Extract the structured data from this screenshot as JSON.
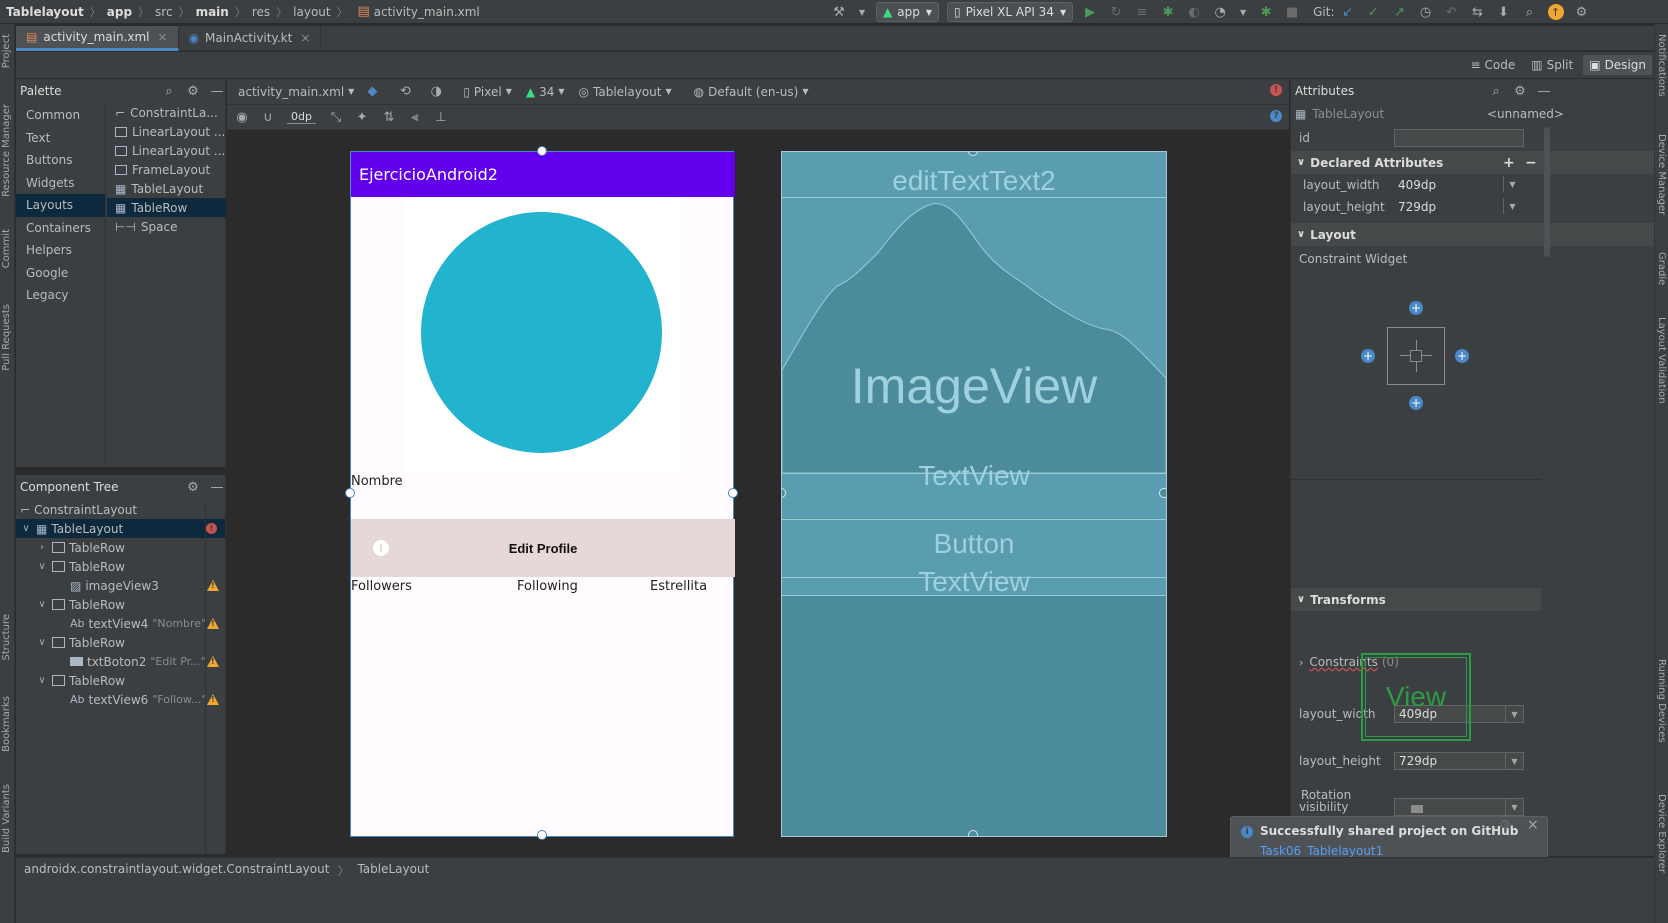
{
  "breadcrumb": [
    "Tablelayout",
    "app",
    "src",
    "main",
    "res",
    "layout",
    "activity_main.xml"
  ],
  "toolbar": {
    "run_config": "app",
    "device": "Pixel XL API 34",
    "git_label": "Git:"
  },
  "tabs": [
    {
      "label": "activity_main.xml"
    },
    {
      "label": "MainActivity.kt"
    }
  ],
  "modes": {
    "code": "Code",
    "split": "Split",
    "design": "Design"
  },
  "left_strip": [
    "Project",
    "Resource Manager",
    "Commit",
    "Pull Requests",
    "Structure",
    "Bookmarks",
    "Build Variants"
  ],
  "right_strip": [
    "Notifications",
    "Device Manager",
    "Gradle",
    "Layout Validation",
    "Running Devices",
    "Device Explorer"
  ],
  "palette": {
    "title": "Palette",
    "categories": [
      "Common",
      "Text",
      "Buttons",
      "Widgets",
      "Layouts",
      "Containers",
      "Helpers",
      "Google",
      "Legacy"
    ],
    "selected_category": "Layouts",
    "items": [
      "ConstraintLa...",
      "LinearLayout ...",
      "LinearLayout ...",
      "FrameLayout",
      "TableLayout",
      "TableRow",
      "Space"
    ]
  },
  "component_tree": {
    "title": "Component Tree",
    "rows": [
      {
        "label": "ConstraintLayout",
        "sub": ""
      },
      {
        "label": "TableLayout",
        "sub": ""
      },
      {
        "label": "TableRow",
        "sub": ""
      },
      {
        "label": "TableRow",
        "sub": ""
      },
      {
        "label": "imageView3",
        "sub": ""
      },
      {
        "label": "TableRow",
        "sub": ""
      },
      {
        "label": "textView4",
        "sub": "\"Nombre\""
      },
      {
        "label": "TableRow",
        "sub": ""
      },
      {
        "label": "txtBoton2",
        "sub": "\"Edit Pr...\""
      },
      {
        "label": "TableRow",
        "sub": ""
      },
      {
        "label": "textView6",
        "sub": "\"Follow...\""
      }
    ]
  },
  "design_toolbar": {
    "file": "activity_main.xml",
    "device": "Pixel",
    "api": "34",
    "theme": "Tablelayout",
    "locale": "Default (en-us)",
    "margin": "0dp"
  },
  "preview": {
    "app_title": "EjercicioAndroid2",
    "nombre": "Nombre",
    "button": "Edit Profile",
    "followers": "Followers",
    "following": "Following",
    "estrellita": "Estrellita"
  },
  "blueprint": {
    "edit": "editTextText2",
    "image": "ImageView",
    "text1": "TextView",
    "button": "Button",
    "text2": "TextView"
  },
  "attributes": {
    "title": "Attributes",
    "component": "TableLayout",
    "unnamed": "<unnamed>",
    "id_label": "id",
    "declared": "Declared Attributes",
    "layout_width_label": "layout_width",
    "layout_width": "409dp",
    "layout_height_label": "layout_height",
    "layout_height": "729dp",
    "layout_section": "Layout",
    "constraint_widget": "Constraint Widget",
    "constraints": "Constraints",
    "constraints_count": "(0)",
    "visibility": "visibility",
    "transforms": "Transforms",
    "view": "View",
    "rotation": "Rotation"
  },
  "toast": {
    "title": "Successfully shared project on GitHub",
    "link": "Task06_Tablelayout1"
  },
  "status": {
    "path": "androidx.constraintlayout.widget.ConstraintLayout",
    "current": "TableLayout"
  },
  "colors": {
    "accent": "#4a88c7",
    "appbar": "#6200ee",
    "circle": "#22b4cf",
    "button_bg": "#e7d8d8",
    "blueprint": "#4b8b9b"
  }
}
